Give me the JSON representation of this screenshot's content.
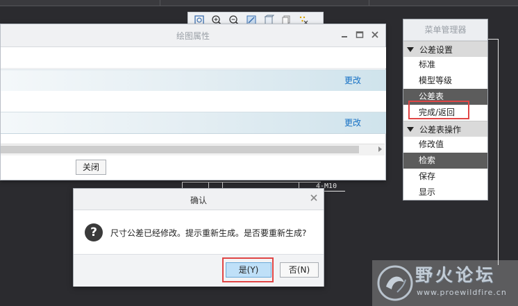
{
  "drawing_window": {
    "title": "绘图属性",
    "rows": [
      {
        "style": "light",
        "action": ""
      },
      {
        "style": "grad",
        "action": "更改"
      },
      {
        "style": "light",
        "action": ""
      },
      {
        "style": "grad",
        "action": "更改"
      }
    ],
    "close_label": "关闭"
  },
  "menu_manager": {
    "title": "菜单管理器",
    "sections": [
      {
        "label": "公差设置",
        "items": [
          {
            "label": "标准",
            "selected": false
          },
          {
            "label": "模型等级",
            "selected": false
          },
          {
            "label": "公差表",
            "selected": true
          },
          {
            "label": "完成/返回",
            "selected": false
          }
        ]
      },
      {
        "label": "公差表操作",
        "items": [
          {
            "label": "修改值",
            "selected": false
          },
          {
            "label": "检索",
            "selected": true
          },
          {
            "label": "保存",
            "selected": false
          },
          {
            "label": "显示",
            "selected": false
          }
        ]
      }
    ]
  },
  "confirm_dialog": {
    "title": "确认",
    "message": "尺寸公差已经修改。提示重新生成。是否要重新生成?",
    "yes_label": "是(Y)",
    "no_label": "否(N)"
  },
  "drawing_annotation": "4-M10",
  "watermark": {
    "text": "野火论坛",
    "url": "www.proewildfire.cn"
  },
  "colors": {
    "highlight_red": "#e04545",
    "link_blue": "#1570c4",
    "selected_item": "#5c5c5c",
    "yes_button": "#bfe0f8"
  }
}
